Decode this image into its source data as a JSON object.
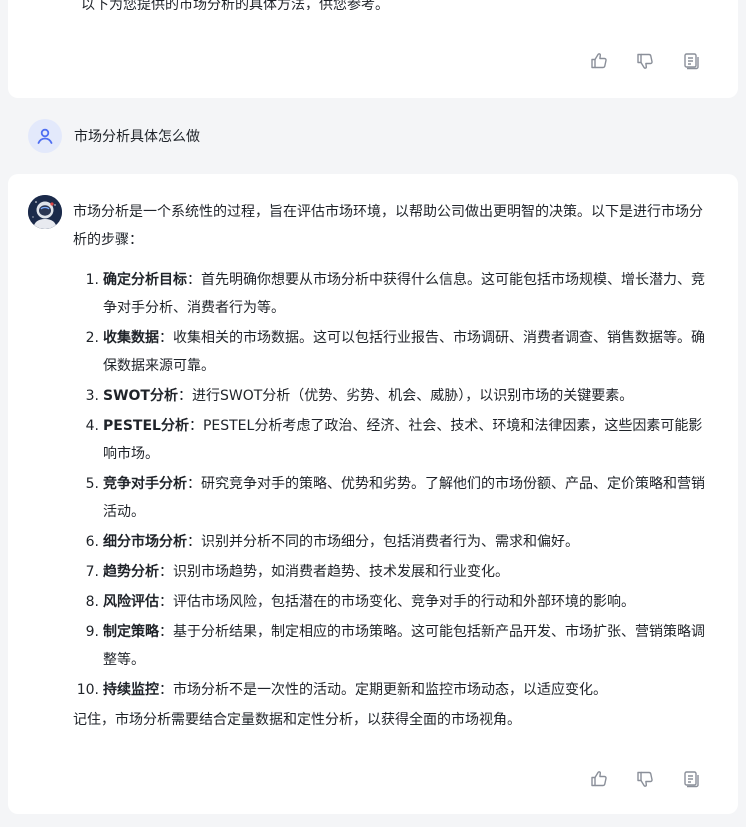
{
  "top_card": {
    "truncated_text": "以下为您提供的市场分析的具体方法，供您参考。"
  },
  "user_message": {
    "text": "市场分析具体怎么做"
  },
  "answer": {
    "intro": "市场分析是一个系统性的过程，旨在评估市场环境，以帮助公司做出更明智的决策。以下是进行市场分析的步骤：",
    "steps": [
      {
        "num": "1.",
        "title": "确定分析目标",
        "text": "：首先明确你想要从市场分析中获得什么信息。这可能包括市场规模、增长潜力、竞争对手分析、消费者行为等。"
      },
      {
        "num": "2.",
        "title": "收集数据",
        "text": "：收集相关的市场数据。这可以包括行业报告、市场调研、消费者调查、销售数据等。确保数据来源可靠。"
      },
      {
        "num": "3.",
        "title": "SWOT分析",
        "text": "：进行SWOT分析（优势、劣势、机会、威胁），以识别市场的关键要素。"
      },
      {
        "num": "4.",
        "title": "PESTEL分析",
        "text": "：PESTEL分析考虑了政治、经济、社会、技术、环境和法律因素，这些因素可能影响市场。"
      },
      {
        "num": "5.",
        "title": "竞争对手分析",
        "text": "：研究竞争对手的策略、优势和劣势。了解他们的市场份额、产品、定价策略和营销活动。"
      },
      {
        "num": "6.",
        "title": "细分市场分析",
        "text": "：识别并分析不同的市场细分，包括消费者行为、需求和偏好。"
      },
      {
        "num": "7.",
        "title": "趋势分析",
        "text": "：识别市场趋势，如消费者趋势、技术发展和行业变化。"
      },
      {
        "num": "8.",
        "title": "风险评估",
        "text": "：评估市场风险，包括潜在的市场变化、竞争对手的行动和外部环境的影响。"
      },
      {
        "num": "9.",
        "title": "制定策略",
        "text": "：基于分析结果，制定相应的市场策略。这可能包括新产品开发、市场扩张、营销策略调整等。"
      },
      {
        "num": "10.",
        "title": "持续监控",
        "text": "：市场分析不是一次性的活动。定期更新和监控市场动态，以适应变化。"
      }
    ],
    "conclusion": "记住，市场分析需要结合定量数据和定性分析，以获得全面的市场视角。"
  },
  "icons": {
    "like": "thumbs-up-icon",
    "dislike": "thumbs-down-icon",
    "copy": "copy-icon"
  },
  "colors": {
    "background": "#f4f5f7",
    "card": "#ffffff",
    "icon": "#8a8f99",
    "user_avatar_bg": "#e3e9fb",
    "user_avatar_fg": "#4e6ef2"
  }
}
